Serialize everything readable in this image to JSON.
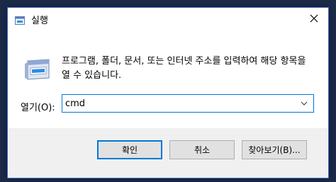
{
  "window": {
    "title": "실행",
    "close_icon": "close-icon"
  },
  "dialog": {
    "description": "프로그램, 폴더, 문서, 또는 인터넷 주소를 입력하여 해당 항목을 열 수 있습니다.",
    "open_label": "열기(O):",
    "open_value": "cmd"
  },
  "buttons": {
    "ok": "확인",
    "cancel": "취소",
    "browse": "찾아보기(B)..."
  },
  "colors": {
    "accent": "#0078d7",
    "footer": "#f0f0f0",
    "button": "#e1e1e1"
  }
}
